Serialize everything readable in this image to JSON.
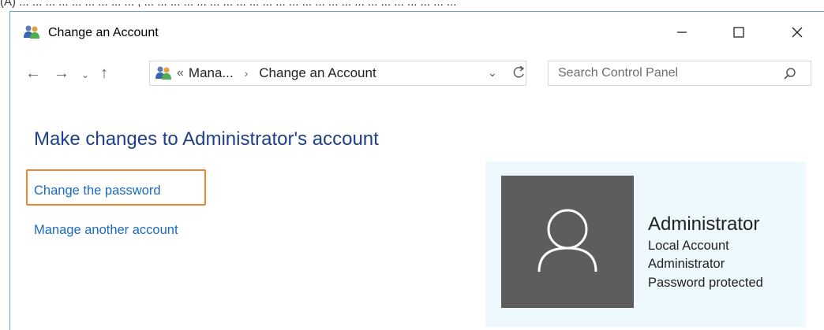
{
  "caption_fragment": "(A) ... ... ... ... ... ... ... ... ... , ... ... ... ... ... ... ... ... ... ... ... ... ... ... ... ... ... ... ... ... ... ... ... ...",
  "window": {
    "title": "Change an Account",
    "controls": {
      "minimize": "minimize-icon",
      "maximize": "maximize-icon",
      "close": "close-icon"
    }
  },
  "navigation": {
    "back": "←",
    "forward": "→",
    "recent": "⌄",
    "up": "↑",
    "breadcrumb": {
      "overflow": "«",
      "parent": "Mana...",
      "separator": "›",
      "current": "Change an Account"
    },
    "dropdown": "⌄"
  },
  "search": {
    "placeholder": "Search Control Panel"
  },
  "content": {
    "heading": "Make changes to Administrator's account",
    "links": {
      "change_password": "Change the password",
      "manage_another": "Manage another account"
    }
  },
  "account": {
    "name": "Administrator",
    "type": "Local Account",
    "role": "Administrator",
    "status": "Password protected"
  },
  "colors": {
    "heading": "#1e3f8a",
    "link": "#1a6bbf",
    "highlight_border": "#f0852d",
    "panel_bg": "#eef9fd",
    "avatar_bg": "#5d5d5d"
  }
}
